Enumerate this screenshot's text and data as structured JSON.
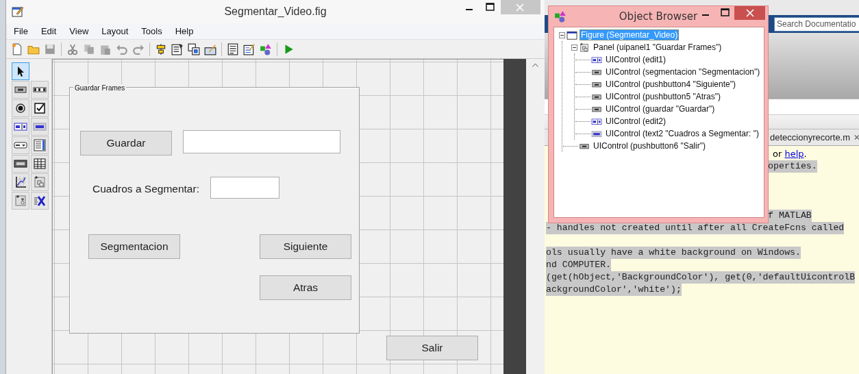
{
  "guide_window": {
    "title": "Segmentar_Video.fig",
    "menu": [
      "File",
      "Edit",
      "View",
      "Layout",
      "Tools",
      "Help"
    ],
    "toolbar": [
      [
        {
          "kind": "new",
          "disabled": false
        },
        {
          "kind": "open",
          "disabled": false
        },
        {
          "kind": "save",
          "disabled": true
        }
      ],
      [
        {
          "kind": "cut",
          "disabled": true
        },
        {
          "kind": "copy",
          "disabled": true
        },
        {
          "kind": "paste",
          "disabled": true
        },
        {
          "kind": "undo",
          "disabled": true
        },
        {
          "kind": "redo",
          "disabled": true
        }
      ],
      [
        {
          "kind": "align",
          "disabled": false
        },
        {
          "kind": "menu-editor",
          "disabled": false
        },
        {
          "kind": "tab-order",
          "disabled": false
        },
        {
          "kind": "toolbar-editor",
          "disabled": false
        }
      ],
      [
        {
          "kind": "editor",
          "disabled": false
        },
        {
          "kind": "inspector",
          "disabled": false
        },
        {
          "kind": "object-browser",
          "disabled": false
        }
      ],
      [
        {
          "kind": "run",
          "disabled": false
        }
      ]
    ],
    "palette": [
      {
        "kind": "pointer",
        "selected": true
      },
      {
        "kind": "pushbutton",
        "selected": false
      },
      {
        "kind": "slider",
        "selected": false
      },
      {
        "kind": "radio",
        "selected": false
      },
      {
        "kind": "checkbox",
        "selected": false
      },
      {
        "kind": "edit",
        "selected": false
      },
      {
        "kind": "text",
        "selected": false
      },
      {
        "kind": "popup",
        "selected": false
      },
      {
        "kind": "listbox",
        "selected": false
      },
      {
        "kind": "toggle",
        "selected": false
      },
      {
        "kind": "table",
        "selected": false
      },
      {
        "kind": "axes",
        "selected": false
      },
      {
        "kind": "panel",
        "selected": false
      },
      {
        "kind": "buttongroup",
        "selected": false
      },
      {
        "kind": "activex",
        "selected": false
      }
    ],
    "panel": {
      "title": "Guardar Frames",
      "controls": [
        {
          "kind": "pushbutton",
          "label": "Guardar"
        },
        {
          "kind": "edit"
        },
        {
          "kind": "text",
          "label": "Cuadros a Segmentar:"
        },
        {
          "kind": "edit"
        },
        {
          "kind": "pushbutton",
          "label": "Segmentacion"
        },
        {
          "kind": "pushbutton",
          "label": "Siguiente"
        },
        {
          "kind": "pushbutton",
          "label": "Atras"
        }
      ]
    },
    "controls": [
      {
        "kind": "pushbutton",
        "label": "Salir"
      }
    ]
  },
  "object_browser": {
    "title": "Object Browser",
    "tree": [
      {
        "kind": "figure",
        "label": "Figure (Segmentar_Video)",
        "selected": true,
        "expanded": true,
        "children": [
          {
            "kind": "panel",
            "label": "Panel (uipanel1 \"Guardar Frames\")",
            "selected": false,
            "expanded": true,
            "children": [
              {
                "kind": "edit",
                "label": "UIControl (edit1)",
                "selected": false
              },
              {
                "kind": "pushbutton",
                "label": "UIControl (segmentacion \"Segmentacion\")",
                "selected": false
              },
              {
                "kind": "pushbutton",
                "label": "UIControl (pushbutton4 \"Siguiente\")",
                "selected": false
              },
              {
                "kind": "pushbutton",
                "label": "UIControl (pushbutton5 \"Atras\")",
                "selected": false
              },
              {
                "kind": "pushbutton",
                "label": "UIControl (guardar \"Guardar\")",
                "selected": false
              },
              {
                "kind": "edit",
                "label": "UIControl (edit2)",
                "selected": false
              },
              {
                "kind": "text",
                "label": "UIControl (text2 \"Cuadros a Segmentar: \")",
                "selected": false
              }
            ]
          },
          {
            "kind": "pushbutton",
            "label": "UIControl (pushbutton6 \"Salir\")",
            "selected": false
          }
        ]
      }
    ]
  },
  "matlab": {
    "search": {
      "placeholder": "Search Documentatio"
    },
    "editor_tabs": [
      {
        "label": "deteccionyrecorte.m"
      }
    ],
    "code_lines": [
      {
        "kind": "help",
        "between": "or",
        "link": "help",
        "end": "."
      },
      {
        "kind": "right",
        "text": "operties."
      },
      {
        "kind": "blank"
      },
      {
        "kind": "blank"
      },
      {
        "kind": "blank"
      },
      {
        "kind": "right",
        "text": "f MATLAB"
      },
      {
        "kind": "full",
        "text": "- handles not created until after all CreateFcns called"
      },
      {
        "kind": "blank"
      },
      {
        "kind": "full",
        "text": "ols usually have a white background on Windows."
      },
      {
        "kind": "full",
        "text": "nd COMPUTER."
      },
      {
        "kind": "full",
        "text": "(get(hObject,'BackgroundColor'), get(0,'defaultUicontrolB"
      },
      {
        "kind": "full",
        "text": "ackgroundColor','white');"
      }
    ]
  }
}
